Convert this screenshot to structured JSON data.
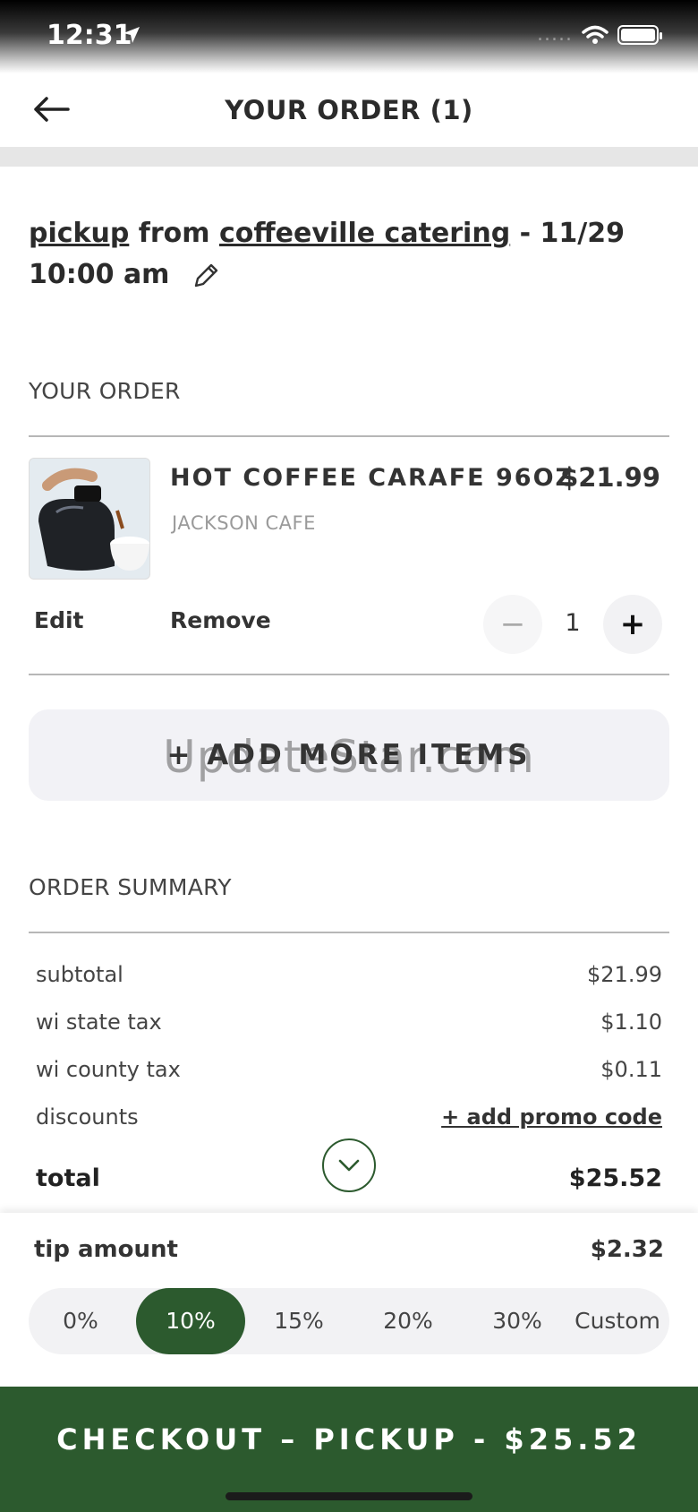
{
  "status": {
    "time": "12:31",
    "signal_dots": "....."
  },
  "header": {
    "title": "YOUR ORDER (1)"
  },
  "pickup": {
    "mode": "pickup",
    "from_word": "from",
    "location": "coffeeville catering",
    "datetime_suffix": "- 11/29",
    "time": "10:00 am"
  },
  "order_section": {
    "label": "YOUR ORDER"
  },
  "item": {
    "name": "HOT COFFEE CARAFE 96OZ",
    "price": "$21.99",
    "vendor": "JACKSON CAFE",
    "edit_label": "Edit",
    "remove_label": "Remove",
    "quantity": "1",
    "minus_symbol": "−",
    "plus_symbol": "+"
  },
  "add_more": {
    "label": "+ ADD MORE ITEMS"
  },
  "watermark": "UpdateStar.com",
  "summary": {
    "label": "ORDER SUMMARY",
    "subtotal_label": "subtotal",
    "subtotal": "$21.99",
    "state_tax_label": "wi state tax",
    "state_tax": "$1.10",
    "county_tax_label": "wi county tax",
    "county_tax": "$0.11",
    "discounts_label": "discounts",
    "promo_link": "+ add promo code",
    "total_label": "total",
    "total": "$25.52"
  },
  "tip": {
    "label": "tip amount",
    "amount": "$2.32",
    "options": [
      "0%",
      "10%",
      "15%",
      "20%",
      "30%",
      "Custom"
    ],
    "selected": "10%"
  },
  "checkout": {
    "label": "CHECKOUT – PICKUP - $25.52"
  },
  "colors": {
    "brand_green": "#2c5a2e",
    "divider": "#e6e6e6"
  }
}
